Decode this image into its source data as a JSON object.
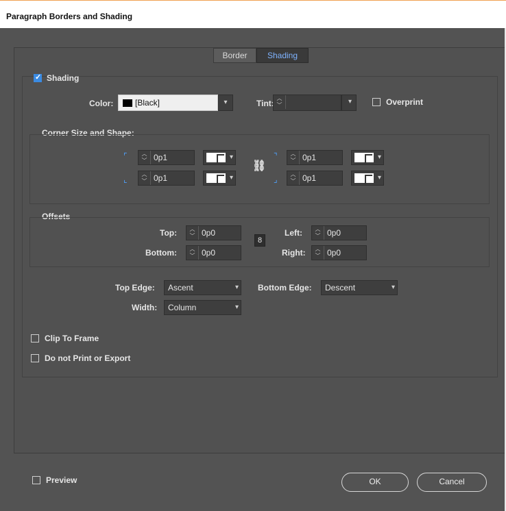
{
  "window": {
    "title": "Paragraph Borders and Shading"
  },
  "tabs": [
    {
      "label": "Border"
    },
    {
      "label": "Shading"
    }
  ],
  "shading": {
    "enable_label": "Shading",
    "enabled": true,
    "color_label": "Color:",
    "color_value": "[Black]",
    "tint_label": "Tint:",
    "tint_value": "",
    "overprint_label": "Overprint",
    "overprint": false
  },
  "corner": {
    "title": "Corner Size and Shape:",
    "top_left": "0p1",
    "bottom_left": "0p1",
    "top_right": "0p1",
    "bottom_right": "0p1"
  },
  "offsets": {
    "title": "Offsets",
    "top_label": "Top:",
    "top_value": "0p0",
    "bottom_label": "Bottom:",
    "bottom_value": "0p0",
    "left_label": "Left:",
    "left_value": "0p0",
    "right_label": "Right:",
    "right_value": "0p0"
  },
  "edges": {
    "top_edge_label": "Top Edge:",
    "top_edge_value": "Ascent",
    "bottom_edge_label": "Bottom Edge:",
    "bottom_edge_value": "Descent",
    "width_label": "Width:",
    "width_value": "Column"
  },
  "options": {
    "clip_label": "Clip To Frame",
    "noprint_label": "Do not Print or Export"
  },
  "footer": {
    "preview_label": "Preview",
    "ok_label": "OK",
    "cancel_label": "Cancel"
  },
  "colors": {
    "accent": "#3b8be2",
    "active_tab_text": "#7fb3ff",
    "background": "#535353"
  }
}
